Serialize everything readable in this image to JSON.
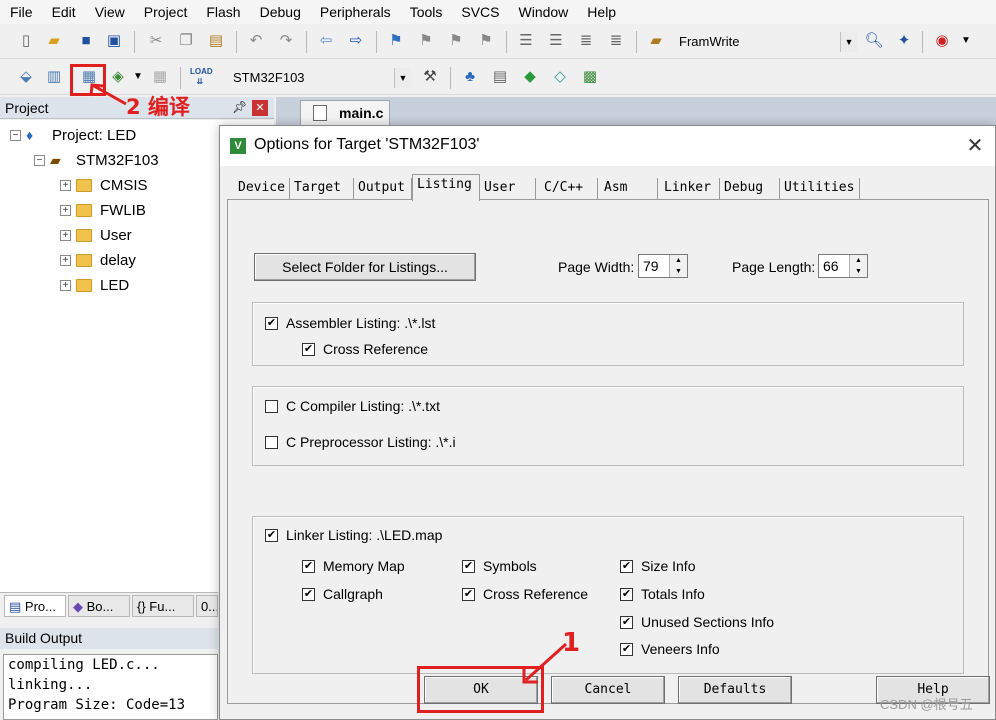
{
  "menu": [
    "File",
    "Edit",
    "View",
    "Project",
    "Flash",
    "Debug",
    "Peripherals",
    "Tools",
    "SVCS",
    "Window",
    "Help"
  ],
  "toolbar1": {
    "find_combo": "FramWrite"
  },
  "toolbar2": {
    "target_combo": "STM32F103",
    "load_label": "LOAD"
  },
  "project_panel": {
    "title": "Project",
    "tree": {
      "root": "Project: LED",
      "target": "STM32F103",
      "groups": [
        "CMSIS",
        "FWLIB",
        "User",
        "delay",
        "LED"
      ]
    }
  },
  "panel_tabs": [
    "Pro...",
    "Bo...",
    "{} Fu...",
    "0..."
  ],
  "build_output": {
    "title": "Build Output",
    "lines": [
      "compiling LED.c...",
      "linking...",
      "Program Size: Code=13"
    ]
  },
  "editor": {
    "active_tab": "main.c"
  },
  "annotations": {
    "compile_label": "2 编译",
    "ok_label": "1"
  },
  "dialog": {
    "title": "Options for Target 'STM32F103'",
    "tabs": [
      "Device",
      "Target",
      "Output",
      "Listing",
      "User",
      "C/C++",
      "Asm",
      "Linker",
      "Debug",
      "Utilities"
    ],
    "active_tab": "Listing",
    "select_folder_button": "Select Folder for Listings...",
    "page_width_label": "Page Width:",
    "page_width_value": "79",
    "page_length_label": "Page Length:",
    "page_length_value": "66",
    "assembler_listing": {
      "label": "Assembler Listing:  .\\*.lst",
      "checked": true
    },
    "assembler_cross_reference": {
      "label": "Cross Reference",
      "checked": true
    },
    "c_compiler_listing": {
      "label": "C Compiler Listing:  .\\*.txt",
      "checked": false
    },
    "c_preprocessor_listing": {
      "label": "C Preprocessor Listing:  .\\*.i",
      "checked": false
    },
    "linker_listing": {
      "label": "Linker Listing:  .\\LED.map",
      "checked": true
    },
    "linker_options": [
      {
        "label": "Memory Map",
        "checked": true
      },
      {
        "label": "Symbols",
        "checked": true
      },
      {
        "label": "Size Info",
        "checked": true
      },
      {
        "label": "Callgraph",
        "checked": true
      },
      {
        "label": "Cross Reference",
        "checked": true
      },
      {
        "label": "Totals Info",
        "checked": true
      },
      {
        "label": "Unused Sections Info",
        "checked": true
      },
      {
        "label": "Veneers Info",
        "checked": true
      }
    ],
    "buttons": {
      "ok": "OK",
      "cancel": "Cancel",
      "defaults": "Defaults",
      "help": "Help"
    }
  },
  "watermark": "CSDN @根号五",
  "colors": {
    "annotation_red": "#e02020",
    "panel_header": "#dde3ea"
  }
}
